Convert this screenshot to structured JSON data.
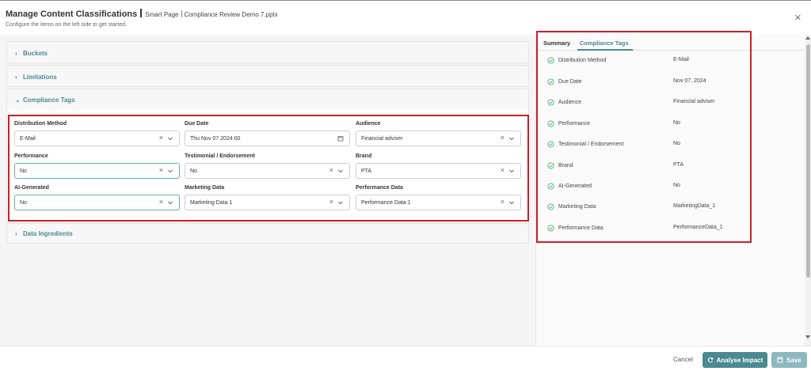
{
  "header": {
    "title": "Manage Content Classifications",
    "crumb1": "Smart Page",
    "crumb2": "Compliance Review Demo 7.pptx",
    "subtitle": "Configure the items on the left side to get started.",
    "close": "✕"
  },
  "sections": {
    "buckets": "Buckets",
    "limitations": "Limitations",
    "compliance_tags": "Compliance Tags",
    "data_ingredients": "Data Ingredients"
  },
  "form": {
    "distribution_method": {
      "label": "Distribution Method",
      "value": "E-Mail"
    },
    "due_date": {
      "label": "Due Date",
      "value": "Thu Nov 07 2024 00"
    },
    "audience": {
      "label": "Audience",
      "value": "Financial adviser"
    },
    "performance": {
      "label": "Performance",
      "value": "No"
    },
    "testimonial": {
      "label": "Testimonial / Endorsement",
      "value": "No"
    },
    "brand": {
      "label": "Brand",
      "value": "PTA"
    },
    "ai_generated": {
      "label": "AI-Generated",
      "value": "No"
    },
    "marketing_data": {
      "label": "Marketing Data",
      "value": "Marketing Data 1"
    },
    "performance_data": {
      "label": "Performance Data",
      "value": "Performance Data 1"
    }
  },
  "summary": {
    "tabs": {
      "summary": "Summary",
      "compliance_tags": "Compliance Tags"
    },
    "rows": [
      {
        "name": "Distribution Method",
        "value": "E-Mail"
      },
      {
        "name": "Due Date",
        "value": "Nov 07, 2024"
      },
      {
        "name": "Audience",
        "value": "Financial adviser"
      },
      {
        "name": "Performance",
        "value": "No"
      },
      {
        "name": "Testimonial / Endorsement",
        "value": "No"
      },
      {
        "name": "Brand",
        "value": "PTA"
      },
      {
        "name": "AI-Generated",
        "value": "No"
      },
      {
        "name": "Marketing Data",
        "value": "MarketingData_1"
      },
      {
        "name": "Performance Data",
        "value": "PerformanceData_1"
      }
    ]
  },
  "footer": {
    "cancel": "Cancel",
    "analyse": "Analyse Impact",
    "save": "Save"
  },
  "colors": {
    "accent": "#4b8a93",
    "highlight_border": "#cc1f2a",
    "check": "#4caf7a"
  }
}
